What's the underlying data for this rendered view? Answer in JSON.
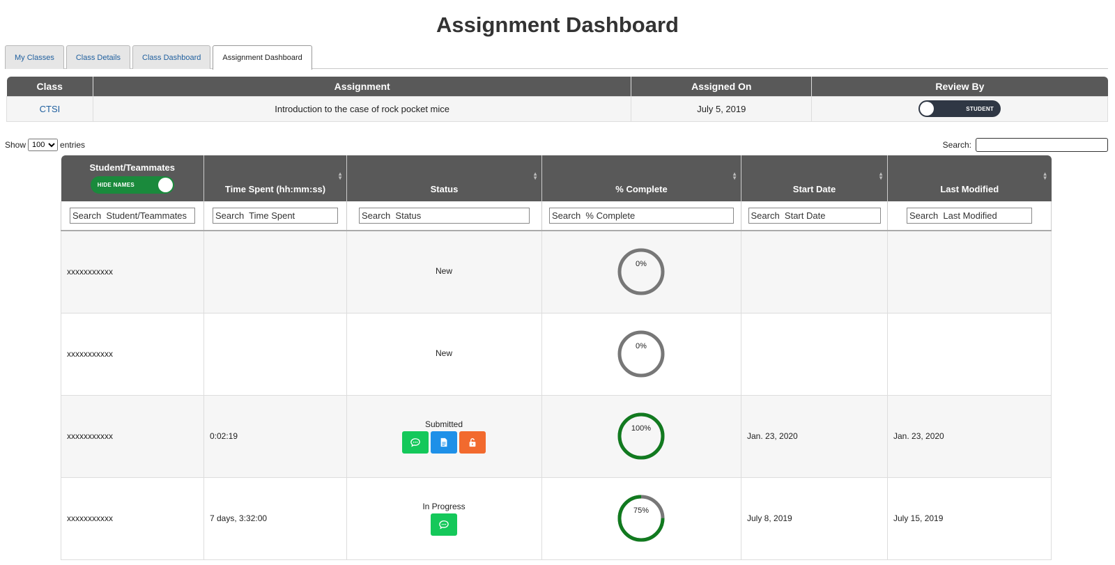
{
  "page": {
    "title": "Assignment Dashboard"
  },
  "tabs": [
    {
      "label": "My Classes",
      "active": false
    },
    {
      "label": "Class Details",
      "active": false
    },
    {
      "label": "Class Dashboard",
      "active": false
    },
    {
      "label": "Assignment Dashboard",
      "active": true
    }
  ],
  "class_info": {
    "headers": {
      "class": "Class",
      "assignment": "Assignment",
      "assigned_on": "Assigned On",
      "review_by": "Review By"
    },
    "class": "CTSI",
    "assignment": "Introduction to the case of rock pocket mice",
    "assigned_on": "July 5, 2019",
    "review_toggle_label": "STUDENT"
  },
  "controls": {
    "show_label": "Show",
    "entries_value": "100",
    "entries_label": "entries",
    "search_label": "Search:"
  },
  "table": {
    "headers": {
      "student": "Student/Teammates",
      "hide_names": "HIDE NAMES",
      "time_spent": "Time Spent (hh:mm:ss)",
      "status": "Status",
      "complete": "% Complete",
      "start_date": "Start Date",
      "last_modified": "Last Modified"
    },
    "filters": {
      "student": "Search  Student/Teammates",
      "time_spent": "Search  Time Spent",
      "status": "Search  Status",
      "complete": "Search  % Complete",
      "start_date": "Search  Start Date",
      "last_modified": "Search  Last Modified"
    },
    "rows": [
      {
        "student": "xxxxxxxxxxx",
        "time_spent": "",
        "status": "New",
        "percent": 0,
        "percent_label": "0%",
        "start_date": "",
        "last_modified": "",
        "actions": []
      },
      {
        "student": "xxxxxxxxxxx",
        "time_spent": "",
        "status": "New",
        "percent": 0,
        "percent_label": "0%",
        "start_date": "",
        "last_modified": "",
        "actions": []
      },
      {
        "student": "xxxxxxxxxxx",
        "time_spent": "0:02:19",
        "status": "Submitted",
        "percent": 100,
        "percent_label": "100%",
        "start_date": "Jan. 23, 2020",
        "last_modified": "Jan. 23, 2020",
        "actions": [
          "comment",
          "document",
          "unlock"
        ]
      },
      {
        "student": "xxxxxxxxxxx",
        "time_spent": "7 days, 3:32:00",
        "status": "In Progress",
        "percent": 75,
        "percent_label": "75%",
        "start_date": "July 8, 2019",
        "last_modified": "July 15, 2019",
        "actions": [
          "comment"
        ]
      }
    ]
  },
  "colors": {
    "header_bg": "#595959",
    "ring_track": "#777777",
    "ring_fill": "#117a1f",
    "btn_comment": "#14c85a",
    "btn_document": "#1e90e8",
    "btn_unlock": "#f26a2e"
  },
  "icons": {
    "comment": "comment-icon",
    "document": "document-icon",
    "unlock": "unlock-icon"
  }
}
